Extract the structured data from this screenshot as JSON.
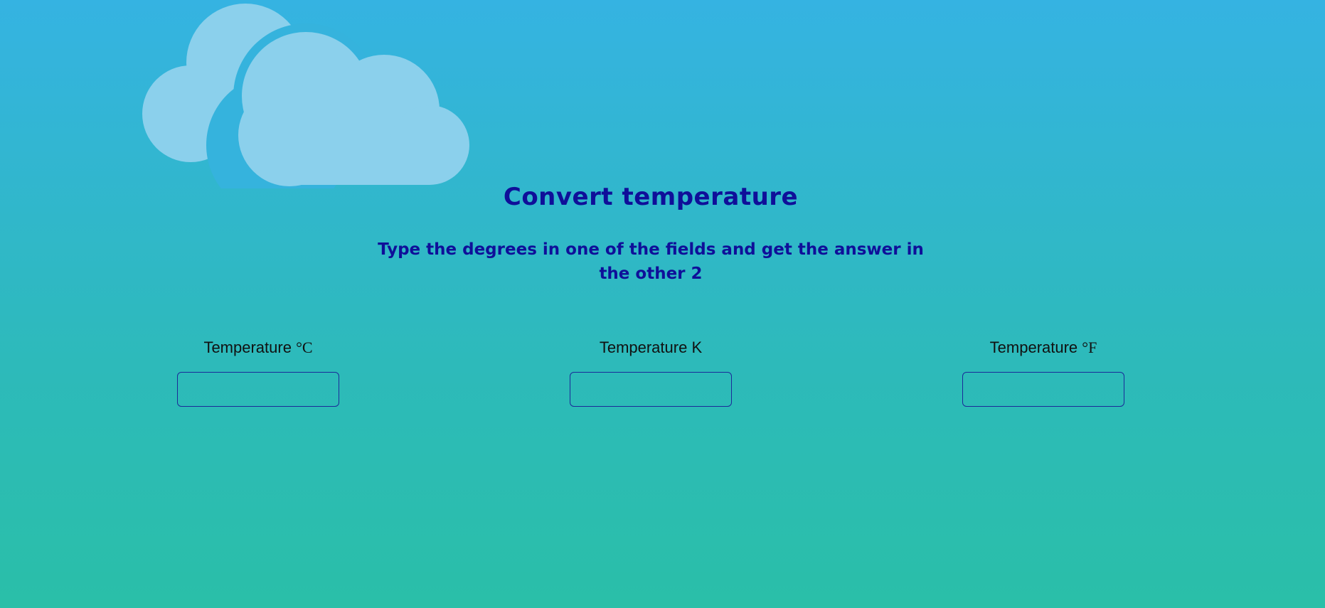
{
  "page": {
    "title": "Convert temperature",
    "subtitle": "Type the degrees in one of the fields and get the answer in the other 2"
  },
  "decor": {
    "icon": "clouds-icon"
  },
  "fields": [
    {
      "label": "Temperature",
      "unit": "°C",
      "value": "",
      "placeholder": ""
    },
    {
      "label": "Temperature",
      "unit": "K",
      "value": "",
      "placeholder": ""
    },
    {
      "label": "Temperature",
      "unit": "°F",
      "value": "",
      "placeholder": ""
    }
  ],
  "colors": {
    "heading": "#0f0f99",
    "cloud": "#8bd0ec",
    "input_border": "#1a2a99"
  }
}
